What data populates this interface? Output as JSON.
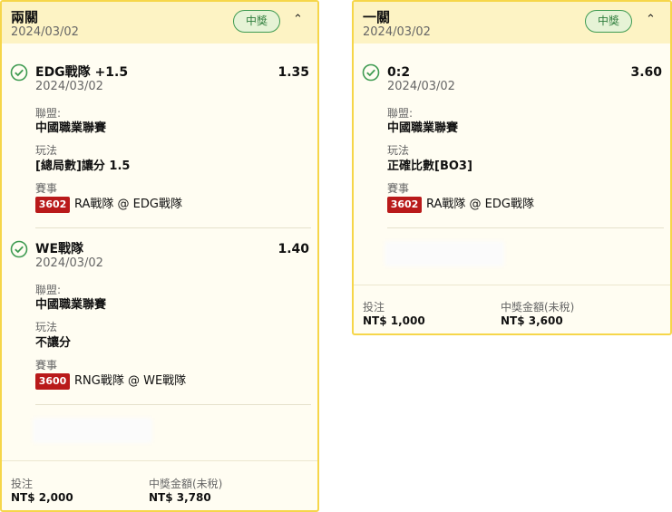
{
  "cards": [
    {
      "title": "兩關",
      "date": "2024/03/02",
      "status": "中獎",
      "collapse_icon": "chevron-up-icon",
      "bets": [
        {
          "title": "EDG戰隊 +1.5",
          "odds": "1.35",
          "date": "2024/03/02",
          "league_label": "聯盟:",
          "league": "中國職業聯賽",
          "market_label": "玩法",
          "market": "[總局數]讓分 1.5",
          "event_label": "賽事",
          "event_code": "3602",
          "event_name": "RA戰隊 @ EDG戰隊"
        },
        {
          "title": "WE戰隊",
          "odds": "1.40",
          "date": "2024/03/02",
          "league_label": "聯盟:",
          "league": "中國職業聯賽",
          "market_label": "玩法",
          "market": "不讓分",
          "event_label": "賽事",
          "event_code": "3600",
          "event_name": "RNG戰隊 @ WE戰隊"
        }
      ],
      "stake_label": "投注",
      "stake": "NT$ 2,000",
      "payout_label": "中獎金額(未稅)",
      "payout": "NT$ 3,780"
    },
    {
      "title": "一關",
      "date": "2024/03/02",
      "status": "中獎",
      "collapse_icon": "chevron-up-icon",
      "bets": [
        {
          "title": "0:2",
          "odds": "3.60",
          "date": "2024/03/02",
          "league_label": "聯盟:",
          "league": "中國職業聯賽",
          "market_label": "玩法",
          "market": "正確比數[BO3]",
          "event_label": "賽事",
          "event_code": "3602",
          "event_name": "RA戰隊 @ EDG戰隊"
        }
      ],
      "stake_label": "投注",
      "stake": "NT$ 1,000",
      "payout_label": "中獎金額(未稅)",
      "payout": "NT$ 3,600"
    }
  ],
  "colors": {
    "card_border": "#f6d64a",
    "card_header": "#fdf3c4",
    "card_body": "#fffdf2",
    "win_green": "#3f9b52",
    "event_code_red": "#b91a1a"
  }
}
